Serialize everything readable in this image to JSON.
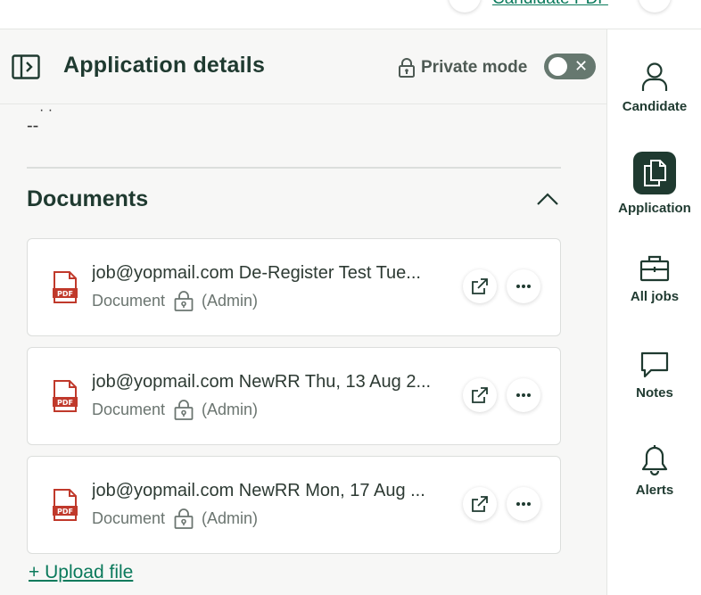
{
  "top": {
    "link": "Candidate PDF"
  },
  "header": {
    "title": "Application details",
    "private_label": "Private mode",
    "private_on": false
  },
  "previous_field": {
    "value": "--"
  },
  "documents": {
    "title": "Documents",
    "items": [
      {
        "name": "job@yopmail.com De-Register Test Tue...",
        "type": "Document",
        "visibility": "(Admin)"
      },
      {
        "name": "job@yopmail.com NewRR Thu, 13 Aug 2...",
        "type": "Document",
        "visibility": "(Admin)"
      },
      {
        "name": "job@yopmail.com NewRR Mon, 17 Aug ...",
        "type": "Document",
        "visibility": "(Admin)"
      }
    ],
    "upload_label": "+ Upload file"
  },
  "rail": {
    "items": [
      {
        "label": "Candidate",
        "icon": "person-icon"
      },
      {
        "label": "Application",
        "icon": "documents-icon",
        "active": true
      },
      {
        "label": "All jobs",
        "icon": "briefcase-icon"
      },
      {
        "label": "Notes",
        "icon": "chat-icon"
      },
      {
        "label": "Alerts",
        "icon": "bell-icon"
      }
    ]
  },
  "colors": {
    "accent": "#0b7a5c",
    "dark": "#1f3a30",
    "pdf_red": "#c0392b",
    "toggle": "#66786f"
  }
}
